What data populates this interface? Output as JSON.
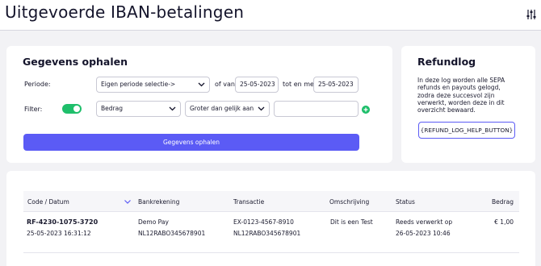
{
  "header": {
    "title": "Uitgevoerde IBAN-betalingen",
    "settings_icon": "sliders-icon"
  },
  "fetch": {
    "title": "Gegevens ophalen",
    "period_label": "Periode:",
    "period_select": "Eigen periode selectie->",
    "from_label": "of van",
    "from_date": "25-05-2023",
    "to_label": "tot en met",
    "to_date": "25-05-2023",
    "filter_label": "Filter:",
    "filter_field": "Bedrag",
    "filter_operator": "Groter dan gelijk aan",
    "filter_value": "",
    "submit_label": "Gegevens ophalen",
    "accent_color": "#5b5bf5",
    "toggle_color": "#1fbf6b"
  },
  "refund": {
    "title": "Refundlog",
    "help": "In deze log worden alle SEPA refunds en payouts gelogd, zodra deze succesvol zijn verwerkt, worden deze in dit overzicht bewaard.",
    "button_label": "{REFUND_LOG_HELP_BUTTON}"
  },
  "table": {
    "columns": [
      "Code / Datum",
      "Bankrekening",
      "Transactie",
      "Omschrijving",
      "Status",
      "Bedrag"
    ],
    "rows": [
      {
        "code": "RF-4230-1075-3720",
        "date": "25-05-2023 16:31:12",
        "bank_name": "Demo Pay",
        "bank_iban": "NL12RABO345678901",
        "transaction": "EX-0123-4567-8910",
        "transaction_iban": "NL12RABO345678901",
        "description": "Dit is een Test",
        "status": "Reeds verwerkt op",
        "status_date": "26-05-2023 10:46",
        "amount": "€ 1,00"
      }
    ]
  }
}
